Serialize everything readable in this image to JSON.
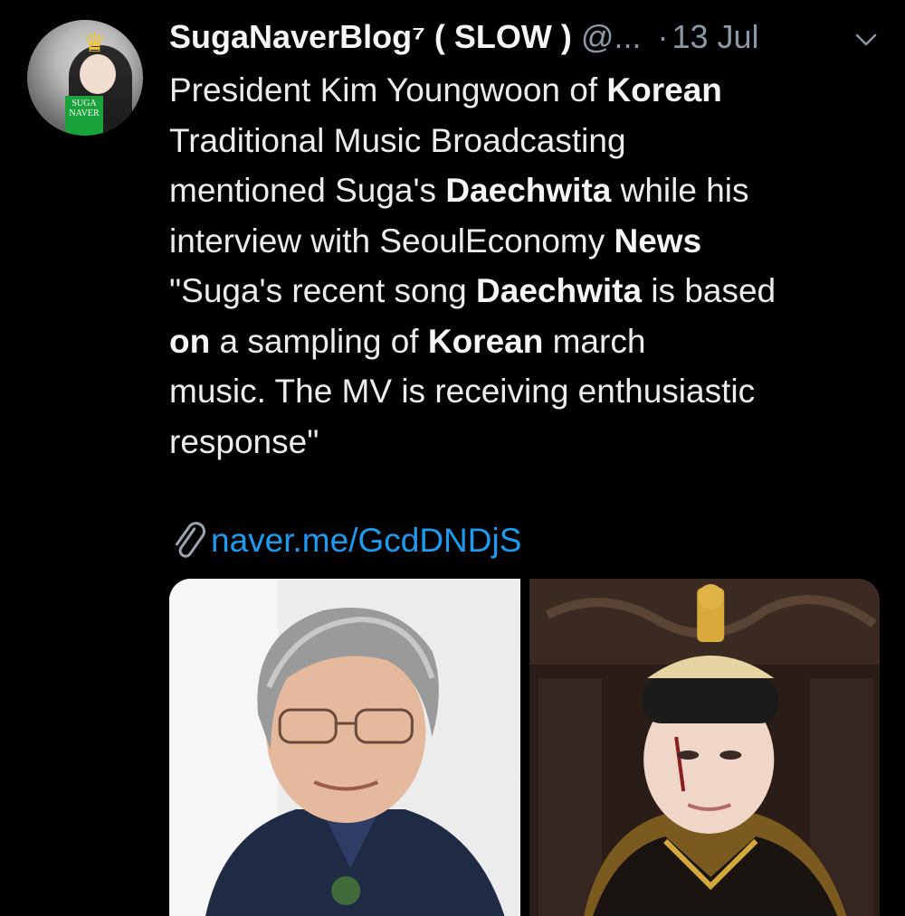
{
  "tweet": {
    "display_name": "SugaNaverBlog⁷ ( SLOW )",
    "handle": "@...",
    "separator": "·",
    "date": "13 Jul",
    "avatar_badge_line1": "SUGA",
    "avatar_badge_line2": "NAVER",
    "body_lines": [
      [
        "President Kim Youngwoon of ",
        "Korean"
      ],
      [
        "Traditional Music Broadcasting"
      ],
      [
        "mentioned Suga's ",
        "Daechwita",
        " while his"
      ],
      [
        "interview with SeoulEconomy ",
        "News"
      ],
      [
        "\"Suga's recent song ",
        "Daechwita",
        " is based"
      ],
      [
        "on",
        " a sampling of ",
        "Korean",
        " march"
      ],
      [
        "music. The MV is receiving enthusiastic"
      ],
      [
        "response\""
      ]
    ],
    "link_text": "naver.me/GcdDNDjS"
  },
  "colors": {
    "background": "#000000",
    "text": "#ececec",
    "muted": "#8b98a5",
    "link": "#1d9bf0"
  },
  "icons": {
    "menu": "chevron-down-icon",
    "link": "paperclip-icon"
  }
}
